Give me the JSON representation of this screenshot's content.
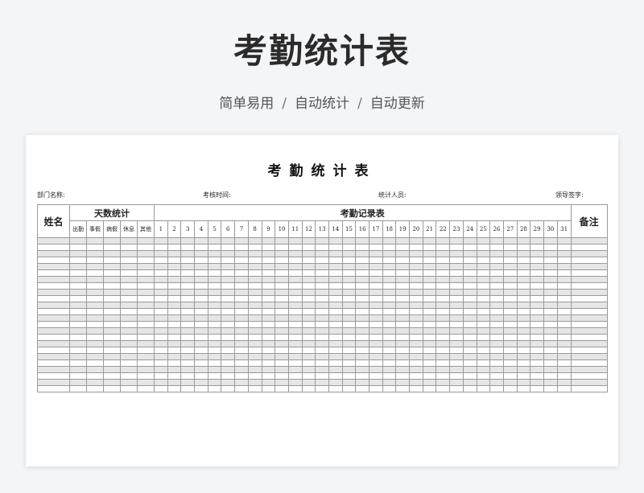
{
  "hero": {
    "title": "考勤统计表",
    "tags": [
      "简单易用",
      "自动统计",
      "自动更新"
    ],
    "separator": "/"
  },
  "sheet": {
    "title": "考勤统计表",
    "fields": {
      "department": "部门名称:",
      "check_time": "考核时间:",
      "statistician": "统计人员:",
      "leader_sign": "领导签字:"
    },
    "table": {
      "name_header": "姓名",
      "days_header": "天数统计",
      "record_header": "考勤记录表",
      "remark_header": "备注",
      "day_stat_columns": [
        "出勤",
        "事假",
        "病假",
        "休息",
        "其他"
      ],
      "day_numbers": [
        "1",
        "2",
        "3",
        "4",
        "5",
        "6",
        "7",
        "8",
        "9",
        "10",
        "11",
        "12",
        "13",
        "14",
        "15",
        "16",
        "17",
        "18",
        "19",
        "20",
        "21",
        "22",
        "23",
        "24",
        "25",
        "26",
        "27",
        "28",
        "29",
        "30",
        "31"
      ],
      "empty_rows": 24
    }
  }
}
